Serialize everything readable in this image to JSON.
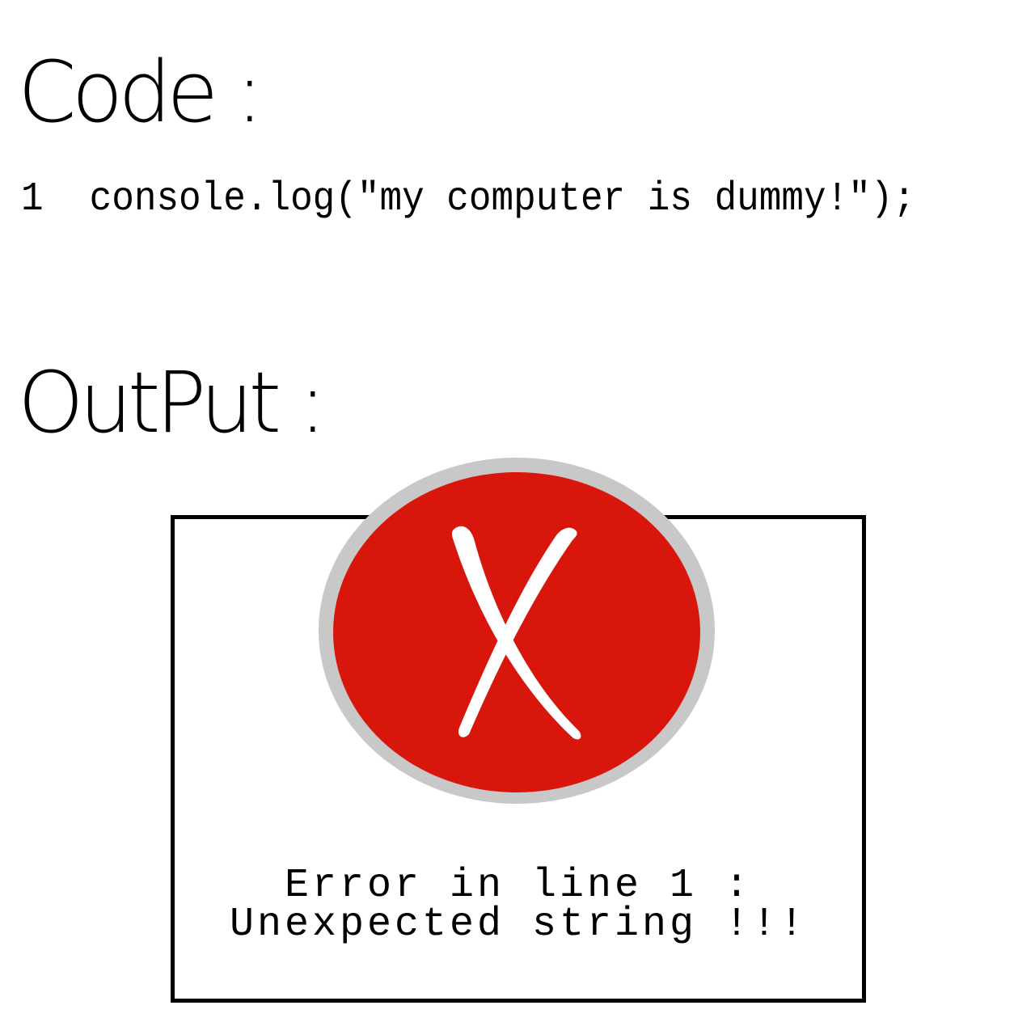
{
  "code_section": {
    "heading": "Code :",
    "line_number": "1",
    "code": "console.log(\"my computer is dummy!\");"
  },
  "output_section": {
    "heading": "OutPut :",
    "error_icon": "error-x-icon",
    "error_line_1": "Error in line 1 :",
    "error_line_2": "Unexpected string !!!"
  },
  "colors": {
    "icon_fill": "#d9160c",
    "icon_ring": "#c8c8c8",
    "icon_mark": "#ffffff",
    "text": "#000000"
  }
}
